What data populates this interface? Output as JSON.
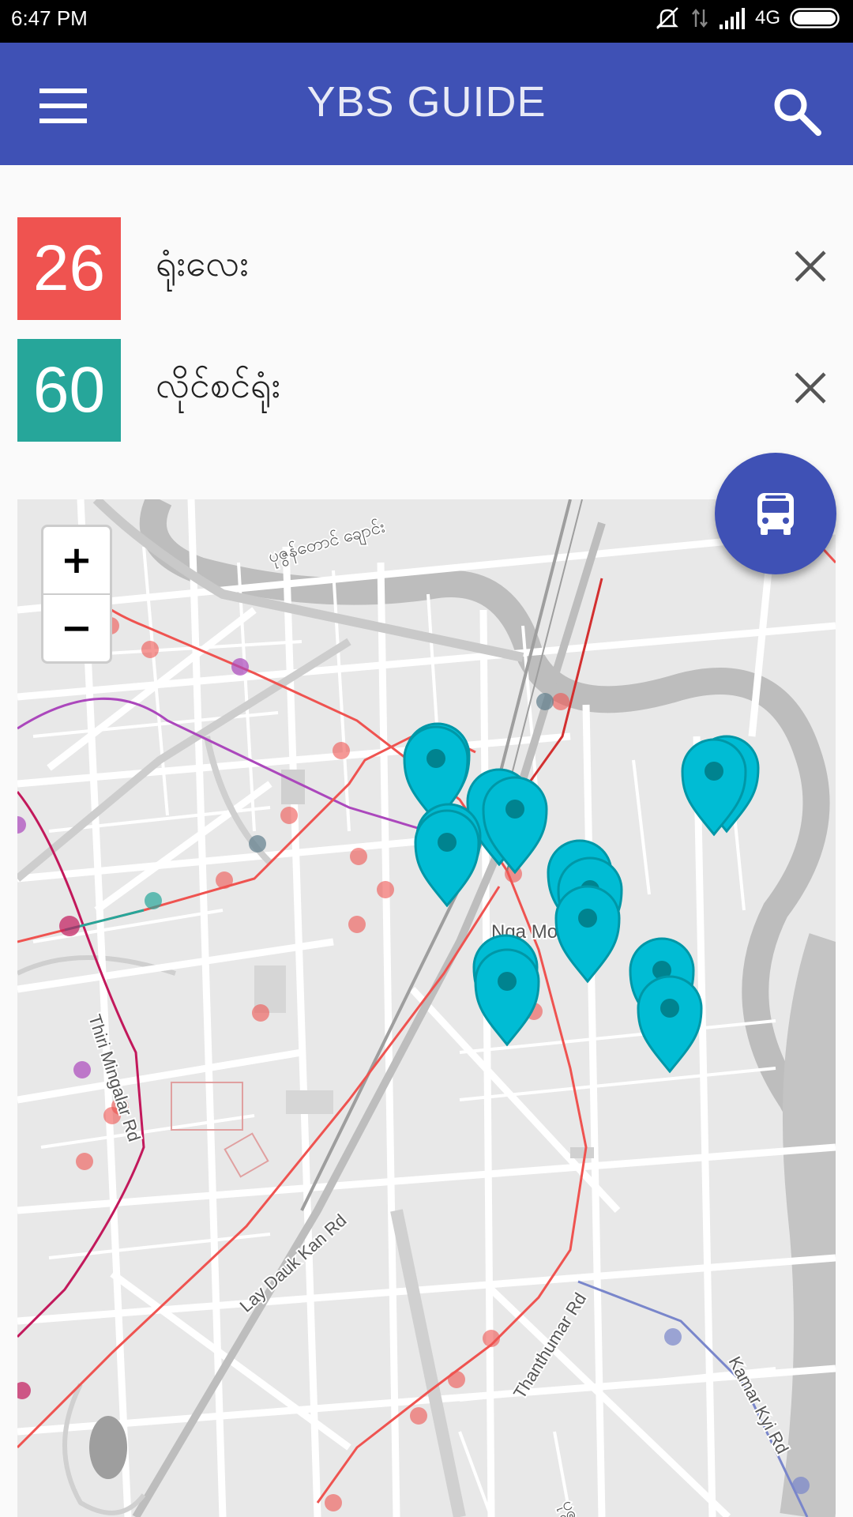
{
  "status_bar": {
    "time": "6:47 PM",
    "network": "4G"
  },
  "app_bar": {
    "title": "YBS GUIDE"
  },
  "routes": [
    {
      "number": "26",
      "name": "ရုံးလေး",
      "color": "#ef5350"
    },
    {
      "number": "60",
      "name": "လိုင်စင်ရုံး",
      "color": "#26a69a"
    }
  ],
  "map": {
    "zoom_in": "+",
    "zoom_out": "−",
    "labels": {
      "river": "ပုဇွန်တောင် ချောင်း",
      "neighborhood": "Nga Mo",
      "road_1": "Thiri Mingalar Rd",
      "road_2": "Lay Dauk Kan Rd",
      "road_3": "Thanthumar Rd",
      "road_4": "Kamar Kyi Rd",
      "road_5": "ပုဇွန်"
    },
    "marker_color": "#00bcd4"
  },
  "fab": {
    "icon": "bus-icon"
  }
}
